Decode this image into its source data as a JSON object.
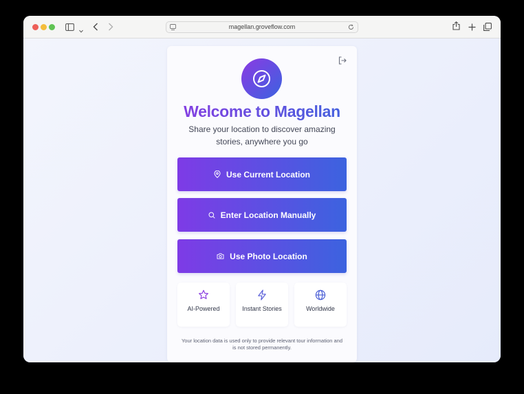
{
  "browser": {
    "url": "magellan.groveflow.com"
  },
  "card": {
    "title": "Welcome to Magellan",
    "subtitle": "Share your location to discover amazing stories, anywhere you go",
    "buttons": [
      {
        "label": "Use Current Location",
        "icon": "map-pin-icon"
      },
      {
        "label": "Enter Location Manually",
        "icon": "search-icon"
      },
      {
        "label": "Use Photo Location",
        "icon": "camera-icon"
      }
    ],
    "features": [
      {
        "label": "AI-Powered",
        "icon": "star-icon"
      },
      {
        "label": "Instant Stories",
        "icon": "lightning-icon"
      },
      {
        "label": "Worldwide",
        "icon": "globe-icon"
      }
    ],
    "privacy_note": "Your location data is used only to provide relevant tour information and is not stored permanently."
  },
  "colors": {
    "accent_start": "#7e3be6",
    "accent_end": "#3c63df"
  }
}
